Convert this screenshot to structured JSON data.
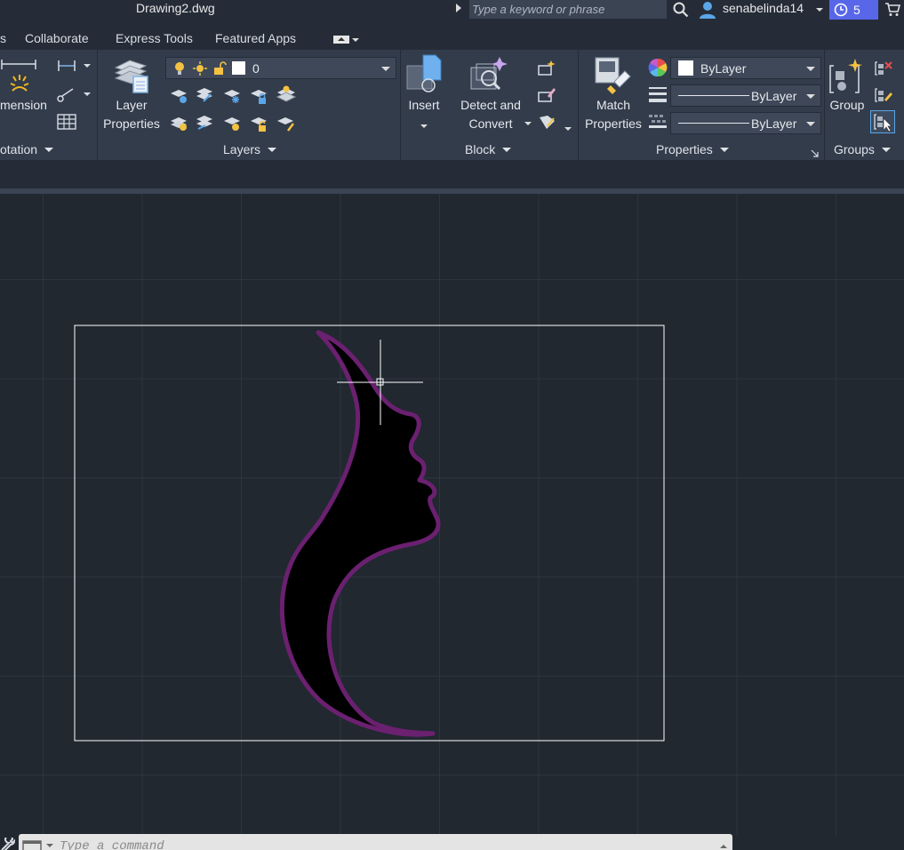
{
  "titlebar": {
    "document_title": "Drawing2.dwg",
    "search_placeholder": "Type a keyword or phrase",
    "user_name": "senabelinda14",
    "trial_badge_count": "5"
  },
  "tabs": [
    {
      "label": "s"
    },
    {
      "label": "Collaborate"
    },
    {
      "label": "Express Tools"
    },
    {
      "label": "Featured Apps"
    }
  ],
  "ribbon": {
    "annotation": {
      "dimension_label": "mension",
      "panel_title": "otation"
    },
    "layers": {
      "layer_properties_label_1": "Layer",
      "layer_properties_label_2": "Properties",
      "current_layer": "0",
      "panel_title": "Layers"
    },
    "block": {
      "insert_label": "Insert",
      "detect_label_1": "Detect and",
      "detect_label_2": "Convert",
      "panel_title": "Block"
    },
    "properties": {
      "match_label_1": "Match",
      "match_label_2": "Properties",
      "color_value": "ByLayer",
      "linetype_value": "ByLayer",
      "lineweight_value": "ByLayer",
      "panel_title": "Properties"
    },
    "groups": {
      "group_label": "Group",
      "panel_title": "Groups"
    }
  },
  "command_line": {
    "placeholder": "Type a command"
  },
  "colors": {
    "canvas_bg": "#212830",
    "ribbon_bg": "#333c4b",
    "shape_stroke": "#6b2070",
    "shape_fill": "#000000",
    "frame": "#ffffff",
    "badge": "#5867e8"
  }
}
